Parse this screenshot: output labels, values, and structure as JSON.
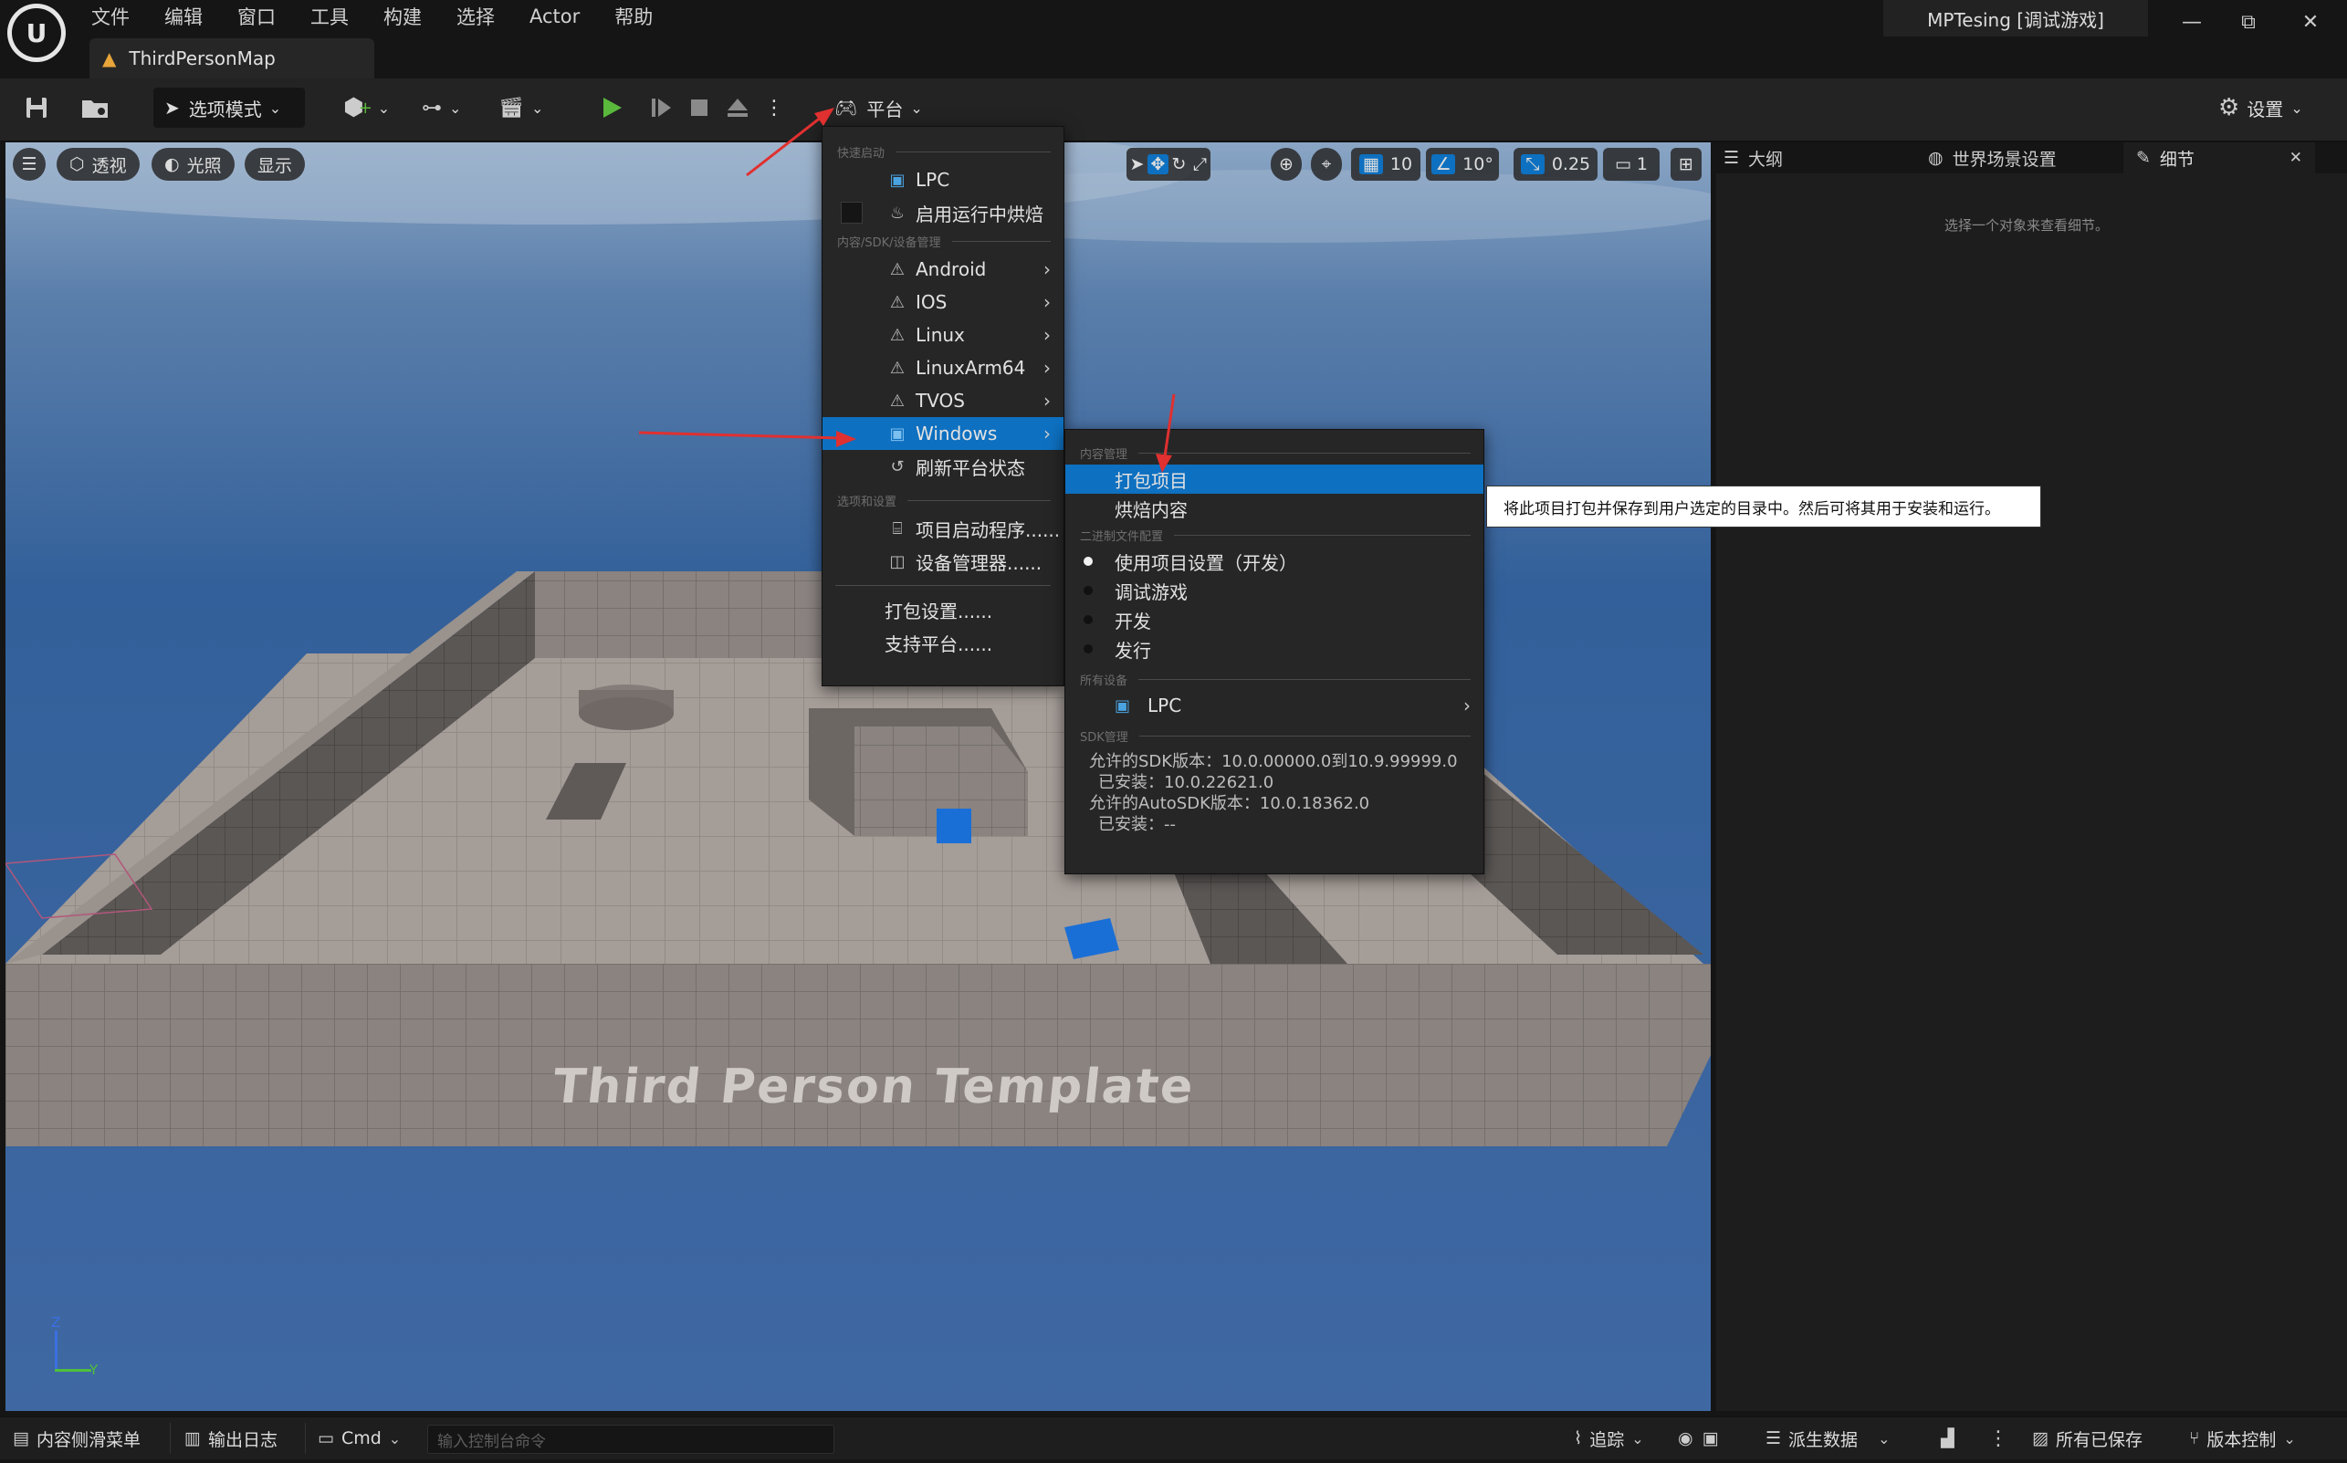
{
  "title_bar": {
    "menu": [
      "文件",
      "编辑",
      "窗口",
      "工具",
      "构建",
      "选择",
      "Actor",
      "帮助"
    ],
    "map_tab": "ThirdPersonMap",
    "project_title": "MPTesing [调试游戏]",
    "window_buttons": [
      "—",
      "⧉",
      "✕"
    ]
  },
  "toolbar": {
    "mode_label": "选项模式",
    "platform_label": "平台",
    "settings_label": "设置"
  },
  "viewport": {
    "perspective_label": "透视",
    "lighting_label": "光照",
    "show_label": "显示",
    "grid_value": "10",
    "angle_value": "10°",
    "scale_value": "0.25",
    "camera_speed": "1",
    "floor_text": "Third Person Template",
    "axis_z": "Z",
    "axis_y": "Y"
  },
  "platform_menu": {
    "quick_launch_header": "快速启动",
    "lpc": "LPC",
    "cook_on_fly": "启用运行中烘焙",
    "content_sdk_header": "内容/SDK/设备管理",
    "platforms": [
      "Android",
      "IOS",
      "Linux",
      "LinuxArm64",
      "TVOS",
      "Windows"
    ],
    "refresh": "刷新平台状态",
    "options_header": "选项和设置",
    "project_launcher": "项目启动程序......",
    "device_manager": "设备管理器......",
    "packaging_settings": "打包设置......",
    "supported_platforms": "支持平台......"
  },
  "windows_submenu": {
    "content_mgmt_header": "内容管理",
    "package_project": "打包项目",
    "cook_content": "烘焙内容",
    "binary_config_header": "二进制文件配置",
    "configs": [
      "使用项目设置（开发）",
      "调试游戏",
      "开发",
      "发行"
    ],
    "all_devices_header": "所有设备",
    "device_lpc": "LPC",
    "sdk_header": "SDK管理",
    "sdk_lines": [
      "允许的SDK版本：10.0.00000.0到10.9.99999.0",
      "已安装：10.0.22621.0",
      "允许的AutoSDK版本：10.0.18362.0",
      "已安装：--"
    ]
  },
  "tooltip": "将此项目打包并保存到用户选定的目录中。然后可将其用于安装和运行。",
  "right_panel": {
    "tab_outliner": "大纲",
    "tab_world_settings": "世界场景设置",
    "tab_details": "细节",
    "empty_hint": "选择一个对象来查看细节。"
  },
  "status_bar": {
    "content_drawer": "内容侧滑菜单",
    "output_log": "输出日志",
    "cmd": "Cmd",
    "console_placeholder": "输入控制台命令",
    "trace": "追踪",
    "derived_data": "派生数据",
    "all_saved": "所有已保存",
    "source_control": "版本控制"
  },
  "colors": {
    "accent": "#0e70c0",
    "play": "#5ab83c",
    "annotation": "#e03030"
  }
}
